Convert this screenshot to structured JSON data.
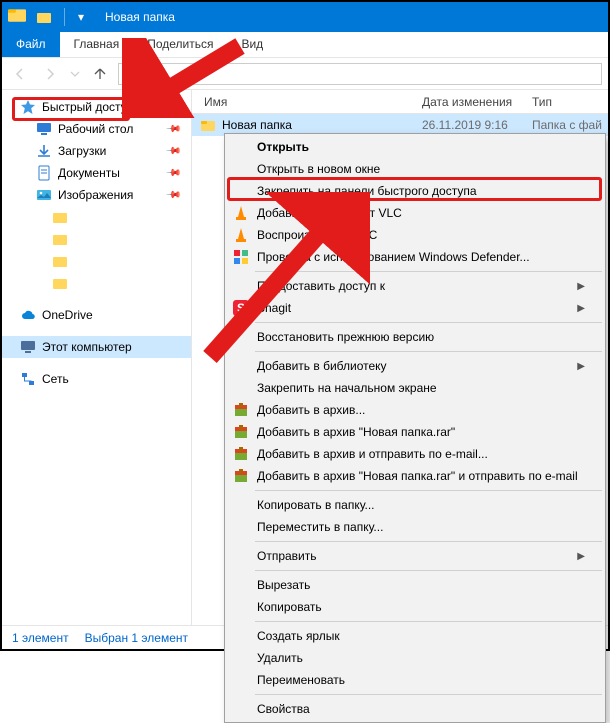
{
  "titlebar": {
    "title": "Новая папка"
  },
  "tabs": {
    "file": "Файл",
    "home": "Главная",
    "share": "Поделиться",
    "view": "Вид"
  },
  "columns": {
    "name": "Имя",
    "date": "Дата изменения",
    "type": "Тип"
  },
  "file_row": {
    "name": "Новая папка",
    "date": "26.11.2019 9:16",
    "type": "Папка с фай"
  },
  "sidebar": {
    "quick_access": "Быстрый доступ",
    "desktop": "Рабочий стол",
    "downloads": "Загрузки",
    "documents": "Документы",
    "pictures": "Изображения",
    "onedrive": "OneDrive",
    "this_pc": "Этот компьютер",
    "network": "Сеть"
  },
  "status": {
    "count": "1 элемент",
    "selected": "Выбран 1 элемент"
  },
  "ctx": {
    "open": "Открыть",
    "open_new_window": "Открыть в новом окне",
    "pin_quick_access": "Закрепить на панели быстрого доступа",
    "add_playlist_vlc": "Добавить в плейлист VLC",
    "play_vlc": "Воспроизвести в VLC",
    "defender": "Проверка с использованием Windows Defender...",
    "grant_access": "Предоставить доступ к",
    "snagit": "Snagit",
    "restore_prev": "Восстановить прежнюю версию",
    "add_library": "Добавить в библиотеку",
    "pin_start": "Закрепить на начальном экране",
    "add_archive": "Добавить в архив...",
    "add_archive_rar": "Добавить в архив \"Новая папка.rar\"",
    "add_archive_email": "Добавить в архив и отправить по e-mail...",
    "add_archive_rar_email": "Добавить в архив \"Новая папка.rar\" и отправить по e-mail",
    "copy_to_folder": "Копировать в папку...",
    "move_to_folder": "Переместить в папку...",
    "send_to": "Отправить",
    "cut": "Вырезать",
    "copy": "Копировать",
    "create_shortcut": "Создать ярлык",
    "delete": "Удалить",
    "rename": "Переименовать",
    "properties": "Свойства"
  }
}
